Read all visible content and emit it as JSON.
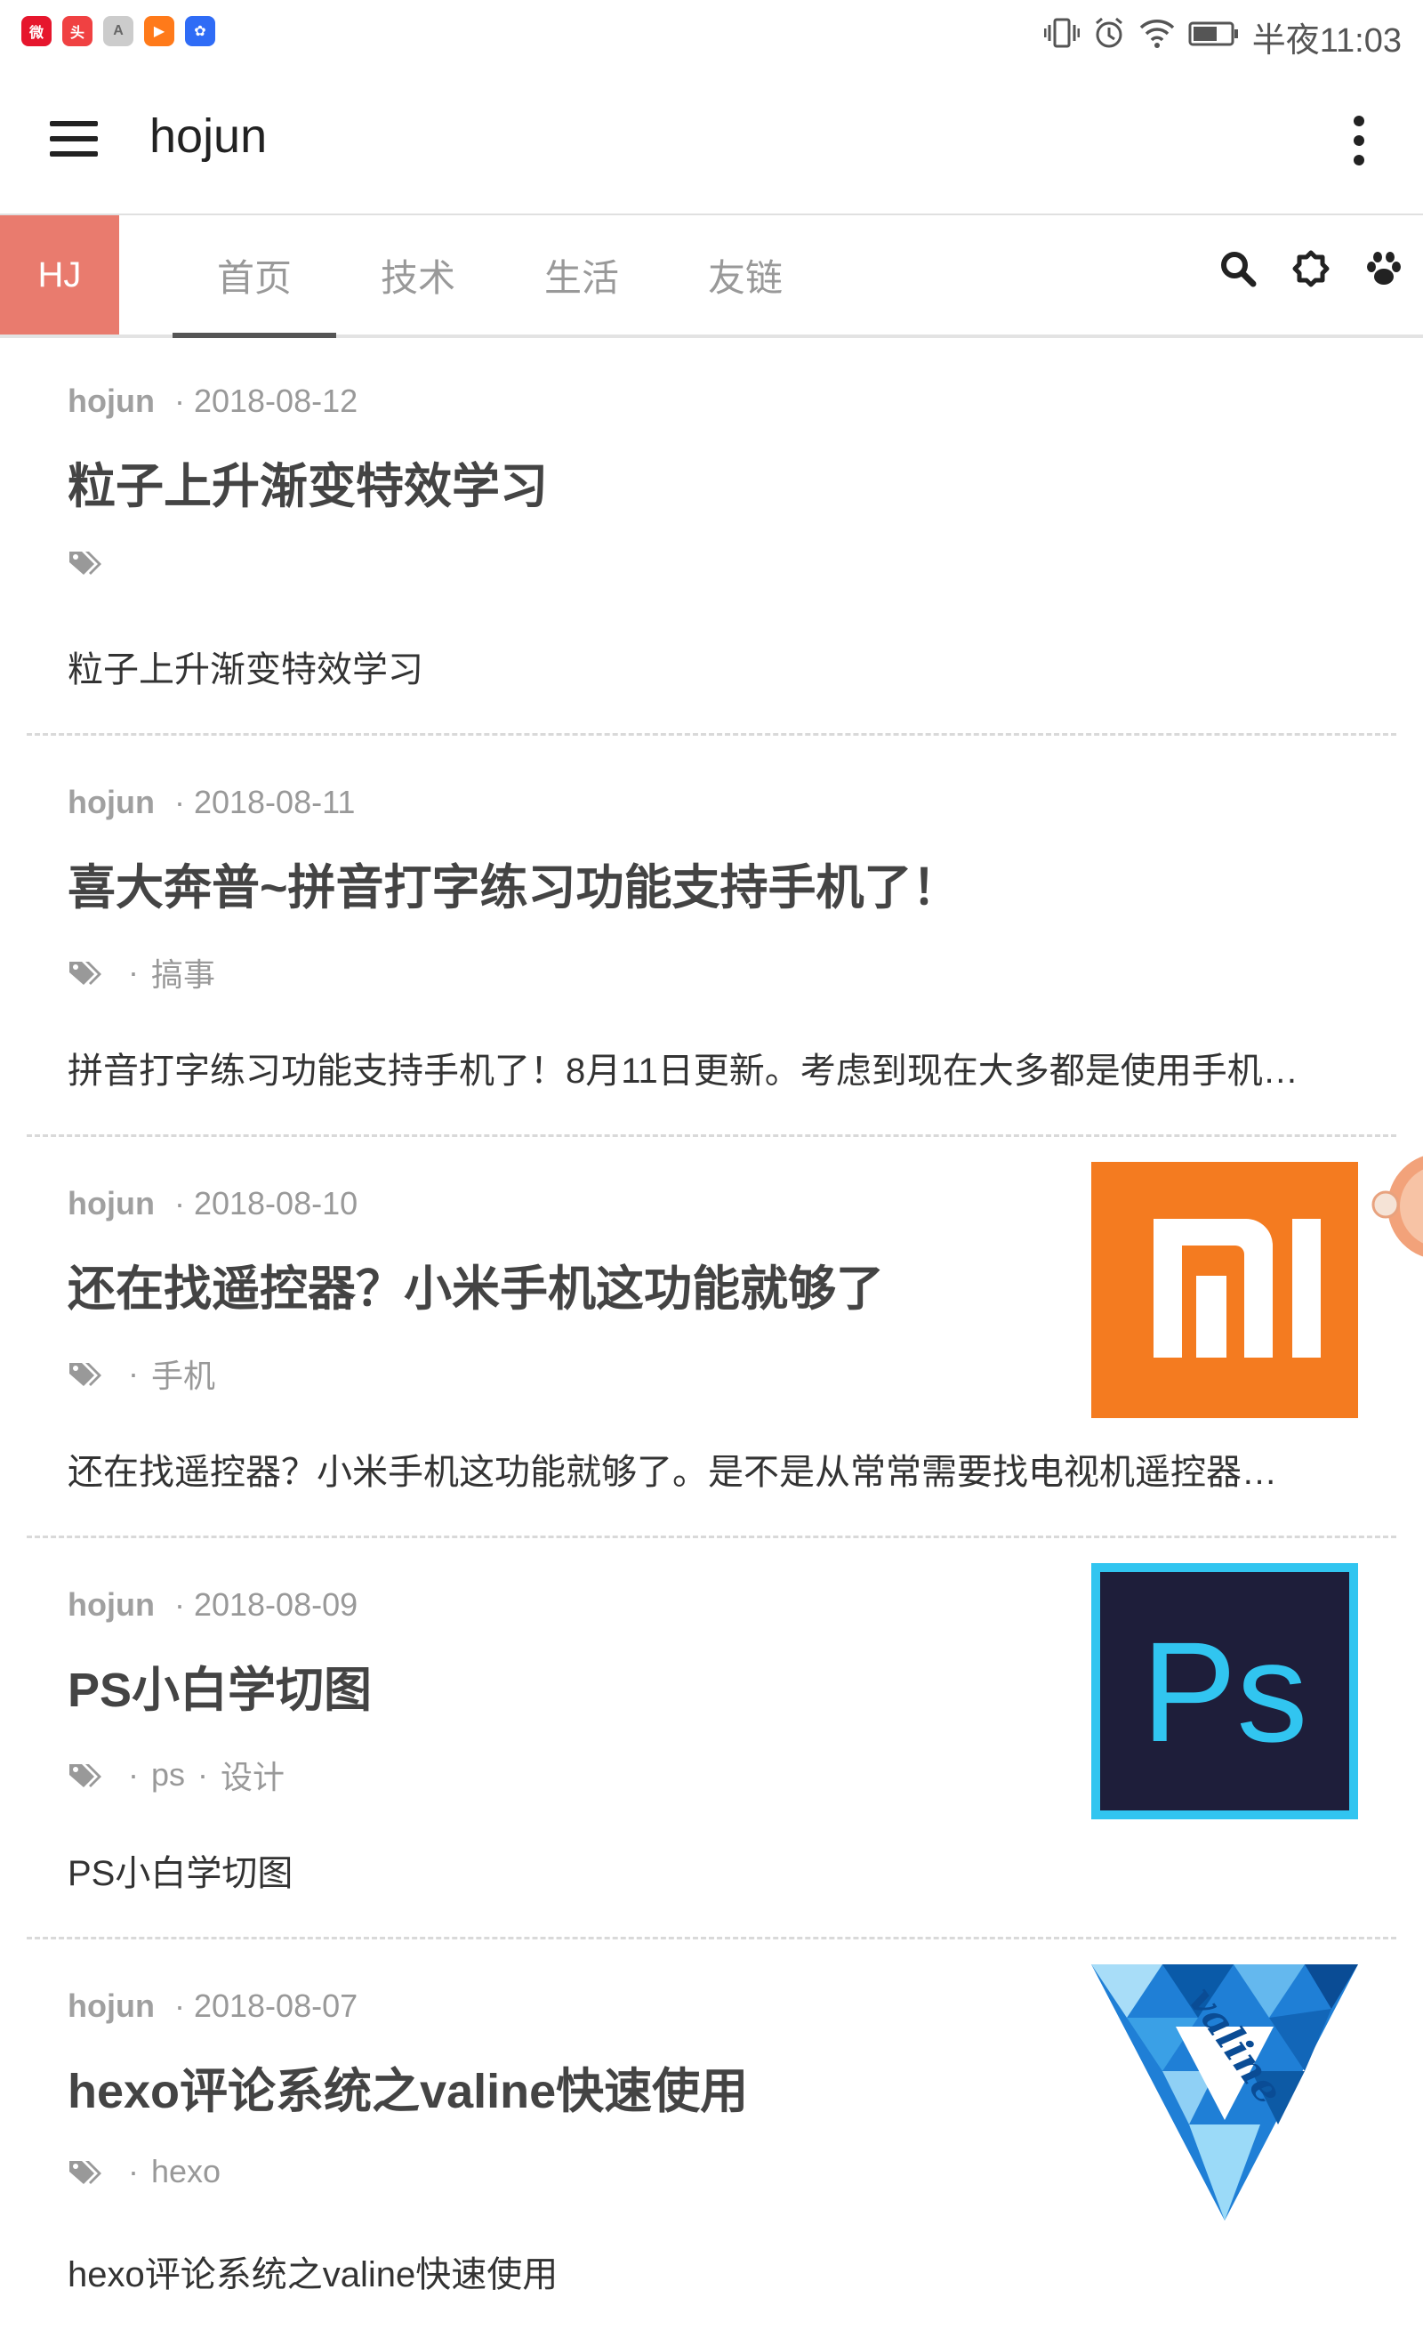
{
  "status": {
    "time": "半夜11:03",
    "apps": [
      {
        "icon": "weibo-icon",
        "color": "#e6162d",
        "label": "微"
      },
      {
        "icon": "toutiao-icon",
        "color": "#f04142",
        "label": "头"
      },
      {
        "icon": "font-app-icon",
        "color": "#cccccc",
        "label": "A"
      },
      {
        "icon": "video-app-icon",
        "color": "#ff7a1a",
        "label": "▶"
      },
      {
        "icon": "baidu-icon",
        "color": "#2f6cf6",
        "label": "✿"
      }
    ]
  },
  "toolbar": {
    "title": "hojun"
  },
  "nav": {
    "brand": "HJ",
    "tabs": [
      "首页",
      "技术",
      "生活",
      "友链"
    ],
    "active_tab": 0
  },
  "posts": [
    {
      "author": "hojun",
      "date": "2018-08-12",
      "title": "粒子上升渐变特效学习",
      "tags": [],
      "excerpt": "粒子上升渐变特效学习",
      "thumb": null
    },
    {
      "author": "hojun",
      "date": "2018-08-11",
      "title": "喜大奔普~拼音打字练习功能支持手机了！",
      "tags": [
        "搞事"
      ],
      "excerpt": "拼音打字练习功能支持手机了！8月11日更新。考虑到现在大多都是使用手机…",
      "thumb": null
    },
    {
      "author": "hojun",
      "date": "2018-08-10",
      "title": "还在找遥控器？小米手机这功能就够了",
      "tags": [
        "手机"
      ],
      "excerpt": "还在找遥控器？小米手机这功能就够了。是不是从常常需要找电视机遥控器…",
      "thumb": "mi"
    },
    {
      "author": "hojun",
      "date": "2018-08-09",
      "title": "PS小白学切图",
      "tags": [
        "ps",
        "设计"
      ],
      "excerpt": "PS小白学切图",
      "thumb": "ps",
      "thumb_text": "Ps"
    },
    {
      "author": "hojun",
      "date": "2018-08-07",
      "title": "hexo评论系统之valine快速使用",
      "tags": [
        "hexo"
      ],
      "excerpt": "hexo评论系统之valine快速使用",
      "thumb": "valine",
      "thumb_text": "valine"
    }
  ]
}
